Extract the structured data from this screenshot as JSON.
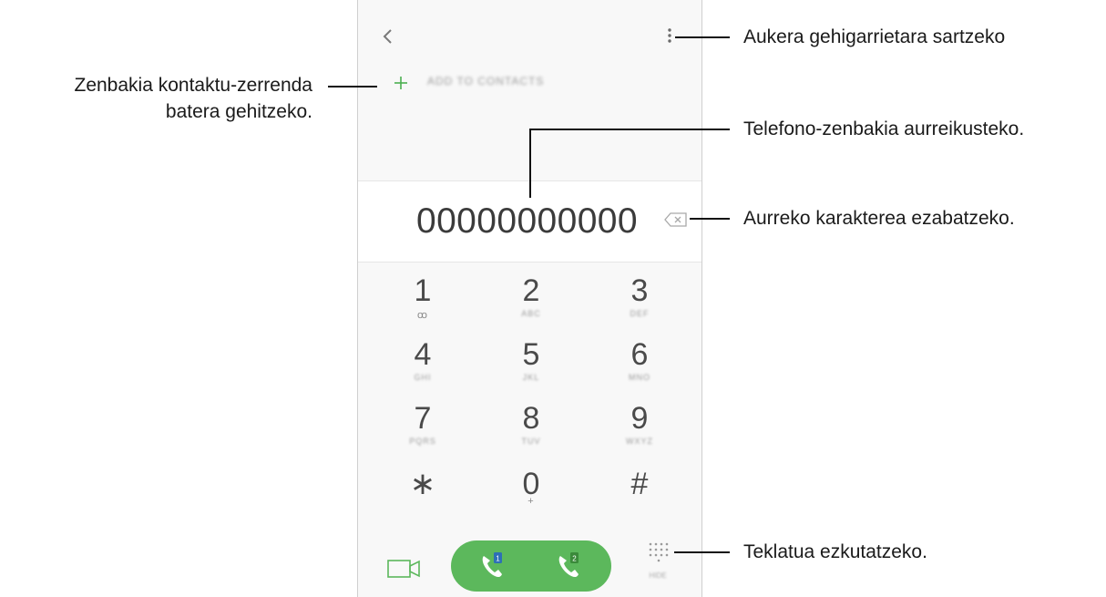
{
  "screen": {
    "add_to_contacts_label": "ADD TO CONTACTS",
    "phone_number": "00000000000",
    "keypad": [
      {
        "digit": "1",
        "letters": "ꝏ",
        "clear": true
      },
      {
        "digit": "2",
        "letters": "ABC"
      },
      {
        "digit": "3",
        "letters": "DEF"
      },
      {
        "digit": "4",
        "letters": "GHI"
      },
      {
        "digit": "5",
        "letters": "JKL"
      },
      {
        "digit": "6",
        "letters": "MNO"
      },
      {
        "digit": "7",
        "letters": "PQRS"
      },
      {
        "digit": "8",
        "letters": "TUV"
      },
      {
        "digit": "9",
        "letters": "WXYZ"
      },
      {
        "digit": "∗",
        "letters": ""
      },
      {
        "digit": "0",
        "letters": "+",
        "clear": true
      },
      {
        "digit": "#",
        "letters": ""
      }
    ],
    "sim_badges": [
      "1",
      "2"
    ],
    "hide_keypad_label": "HIDE",
    "accent_color": "#5cb85c"
  },
  "callouts": {
    "more_options": "Aukera gehigarrietara sartzeko",
    "add_to_contacts_line1": "Zenbakia kontaktu-zerrenda",
    "add_to_contacts_line2": "batera gehitzeko.",
    "preview_number": "Telefono-zenbakia aurreikusteko.",
    "delete_char": "Aurreko karakterea ezabatzeko.",
    "hide_keypad": "Teklatua ezkutatzeko."
  }
}
